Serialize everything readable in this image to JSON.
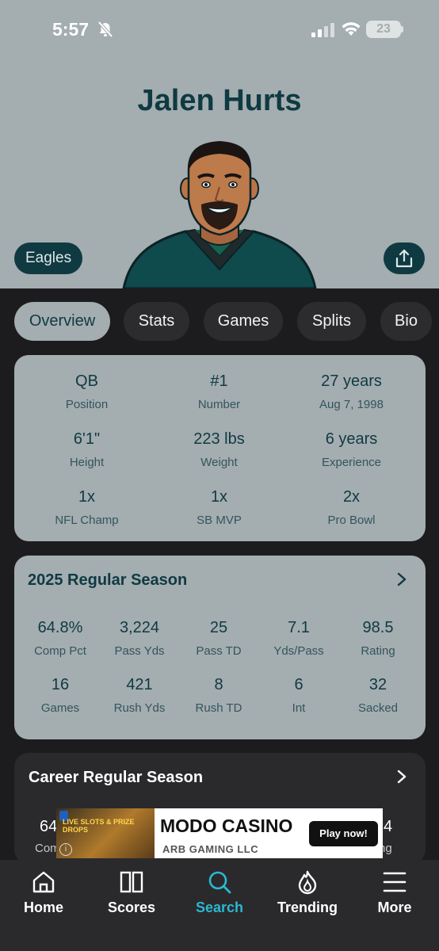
{
  "status_bar": {
    "time": "5:57",
    "battery": "23"
  },
  "player": {
    "name": "Jalen Hurts",
    "team": "Eagles"
  },
  "tabs": [
    "Overview",
    "Stats",
    "Games",
    "Splits",
    "Bio"
  ],
  "active_tab": "Overview",
  "info": [
    {
      "value": "QB",
      "label": "Position"
    },
    {
      "value": "#1",
      "label": "Number"
    },
    {
      "value": "27 years",
      "label": "Aug 7, 1998"
    },
    {
      "value": "6'1\"",
      "label": "Height"
    },
    {
      "value": "223 lbs",
      "label": "Weight"
    },
    {
      "value": "6 years",
      "label": "Experience"
    },
    {
      "value": "1x",
      "label": "NFL Champ"
    },
    {
      "value": "1x",
      "label": "SB MVP"
    },
    {
      "value": "2x",
      "label": "Pro Bowl"
    }
  ],
  "season": {
    "title": "2025 Regular Season",
    "stats": [
      {
        "value": "64.8%",
        "label": "Comp Pct"
      },
      {
        "value": "3,224",
        "label": "Pass Yds"
      },
      {
        "value": "25",
        "label": "Pass TD"
      },
      {
        "value": "7.1",
        "label": "Yds/Pass"
      },
      {
        "value": "98.5",
        "label": "Rating"
      },
      {
        "value": "16",
        "label": "Games"
      },
      {
        "value": "421",
        "label": "Rush Yds"
      },
      {
        "value": "8",
        "label": "Rush TD"
      },
      {
        "value": "6",
        "label": "Int"
      },
      {
        "value": "32",
        "label": "Sacked"
      }
    ]
  },
  "career": {
    "title": "Career Regular Season",
    "partial_left_value": "64",
    "partial_left_label": "Com",
    "partial_right_value": "4",
    "partial_right_label": "ng"
  },
  "ad": {
    "image_text": "LIVE SLOTS & PRIZE DROPS",
    "title": "MODO CASINO",
    "subtitle": "ARB GAMING LLC",
    "cta": "Play now!",
    "info_glyph": "i"
  },
  "nav": [
    {
      "label": "Home",
      "icon": "home-icon"
    },
    {
      "label": "Scores",
      "icon": "scores-icon"
    },
    {
      "label": "Search",
      "icon": "search-icon"
    },
    {
      "label": "Trending",
      "icon": "flame-icon"
    },
    {
      "label": "More",
      "icon": "menu-icon"
    }
  ],
  "colors": {
    "hero_bg": "#a4adb0",
    "brand_teal": "#0f3a42",
    "active_nav": "#2bb8d4",
    "app_bg": "#1c1c1e"
  }
}
